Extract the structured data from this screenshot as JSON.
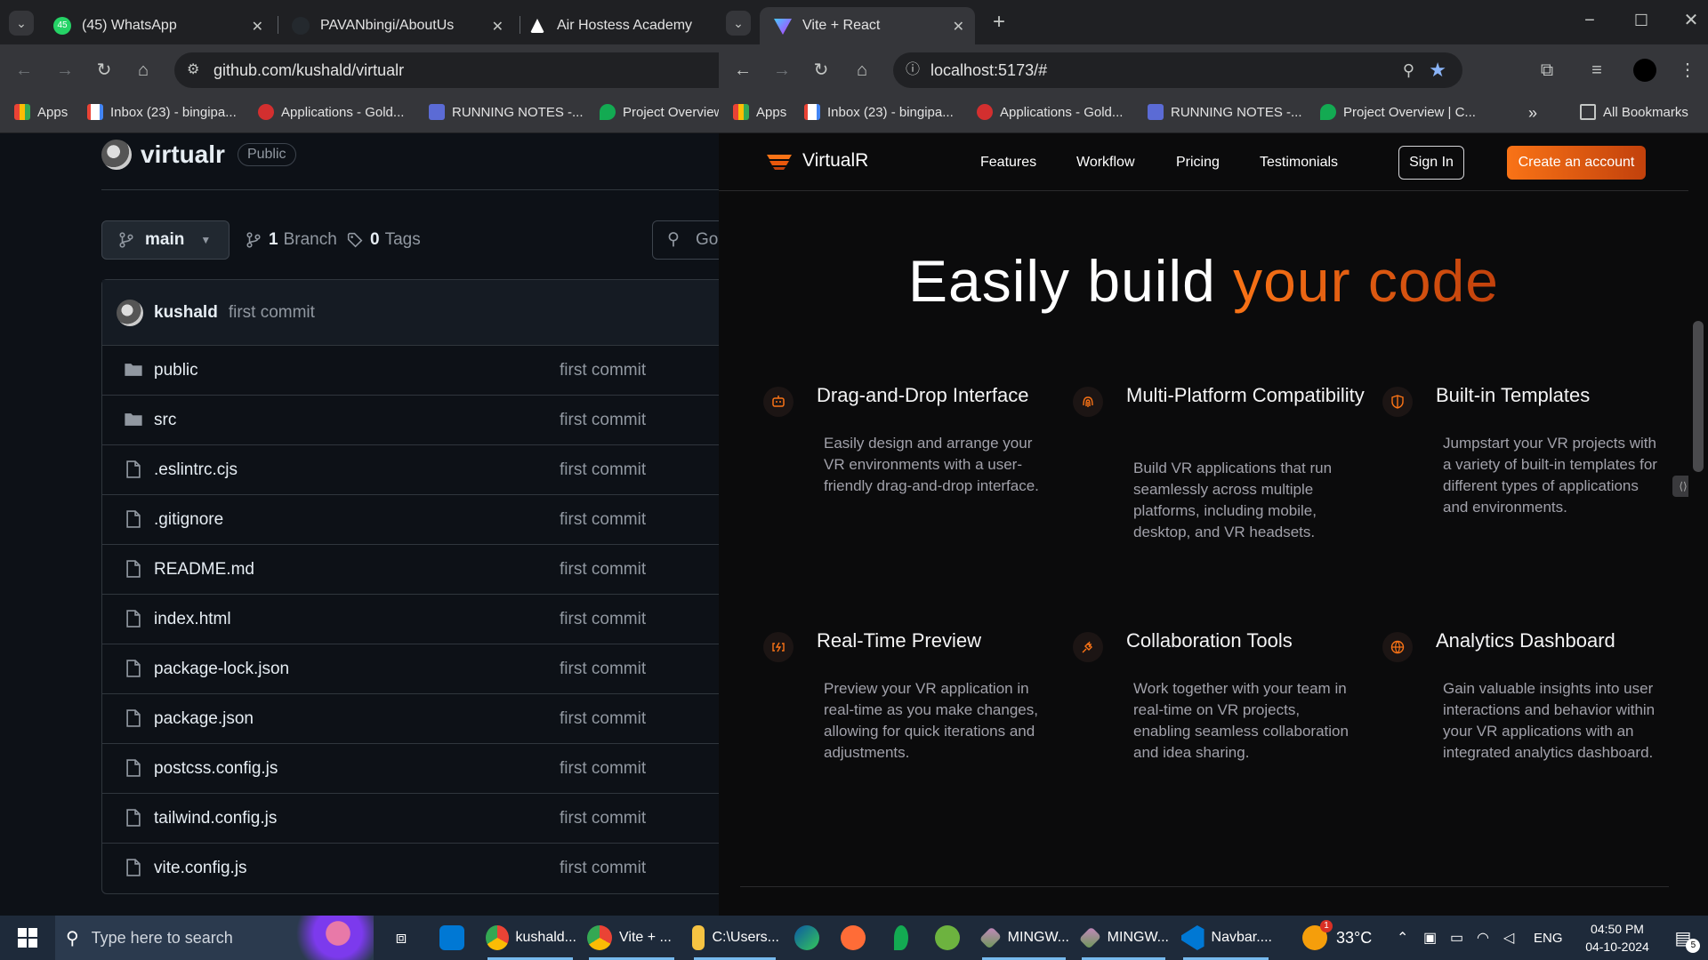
{
  "left_window": {
    "tabs": [
      {
        "label": "(45) WhatsApp",
        "badge": "45"
      },
      {
        "label": "PAVANbingi/AboutUs"
      },
      {
        "label": "Air Hostess Academy"
      }
    ],
    "url": "github.com/kushald/virtualr",
    "bookmarks": [
      "Apps",
      "Inbox (23) - bingipa...",
      "Applications - Gold...",
      "RUNNING NOTES -...",
      "Project Overview"
    ],
    "repo": {
      "name": "virtualr",
      "visibility": "Public",
      "branch": "main",
      "branches_count": "1",
      "branches_label": "Branch",
      "tags_count": "0",
      "tags_label": "Tags",
      "goto_placeholder": "Go",
      "last_commit_user": "kushald",
      "last_commit_message": "first commit",
      "files": [
        {
          "name": "public",
          "type": "folder",
          "commit": "first commit"
        },
        {
          "name": "src",
          "type": "folder",
          "commit": "first commit"
        },
        {
          "name": ".eslintrc.cjs",
          "type": "file",
          "commit": "first commit"
        },
        {
          "name": ".gitignore",
          "type": "file",
          "commit": "first commit"
        },
        {
          "name": "README.md",
          "type": "file",
          "commit": "first commit"
        },
        {
          "name": "index.html",
          "type": "file",
          "commit": "first commit"
        },
        {
          "name": "package-lock.json",
          "type": "file",
          "commit": "first commit"
        },
        {
          "name": "package.json",
          "type": "file",
          "commit": "first commit"
        },
        {
          "name": "postcss.config.js",
          "type": "file",
          "commit": "first commit"
        },
        {
          "name": "tailwind.config.js",
          "type": "file",
          "commit": "first commit"
        },
        {
          "name": "vite.config.js",
          "type": "file",
          "commit": "first commit"
        }
      ]
    }
  },
  "right_window": {
    "tab": "Vite + React",
    "url": "localhost:5173/#",
    "bookmarks": [
      "Apps",
      "Inbox (23) - bingipa...",
      "Applications - Gold...",
      "RUNNING NOTES -...",
      "Project Overview | C...",
      "All Bookmarks"
    ],
    "app": {
      "brand": "VirtualR",
      "nav": [
        "Features",
        "Workflow",
        "Pricing",
        "Testimonials"
      ],
      "sign_in": "Sign In",
      "create_account": "Create an account",
      "hero_plain": "Easily build",
      "hero_accent": "your code",
      "features": [
        {
          "title": "Drag-and-Drop Interface",
          "icon": "bot-icon",
          "desc": "Easily design and arrange your VR environments with a user-friendly drag-and-drop interface."
        },
        {
          "title": "Multi-Platform Compatibility",
          "icon": "fingerprint-icon",
          "desc": "Build VR applications that run seamlessly across multiple platforms, including mobile, desktop, and VR headsets."
        },
        {
          "title": "Built-in Templates",
          "icon": "shield-half-icon",
          "desc": "Jumpstart your VR projects with a variety of built-in templates for different types of applications and environments."
        },
        {
          "title": "Real-Time Preview",
          "icon": "battery-charging-icon",
          "desc": "Preview your VR application in real-time as you make changes, allowing for quick iterations and adjustments."
        },
        {
          "title": "Collaboration Tools",
          "icon": "plug-zap-icon",
          "desc": "Work together with your team in real-time on VR projects, enabling seamless collaboration and idea sharing."
        },
        {
          "title": "Analytics Dashboard",
          "icon": "globe-lock-icon",
          "desc": "Gain valuable insights into user interactions and behavior within your VR applications with an integrated analytics dashboard."
        }
      ]
    }
  },
  "taskbar": {
    "search_placeholder": "Type here to search",
    "apps": [
      "kushald...",
      "Vite + ...",
      "C:\\Users...",
      "MINGW...",
      "MINGW...",
      "Navbar...."
    ],
    "weather": "33°C",
    "weather_badge": "1",
    "language": "ENG",
    "time": "04:50 PM",
    "date": "04-10-2024",
    "notifications": "5"
  },
  "colors": {
    "accent": "#f97316",
    "github_bg": "#0d1117",
    "app_bg": "#0b0b0c"
  }
}
